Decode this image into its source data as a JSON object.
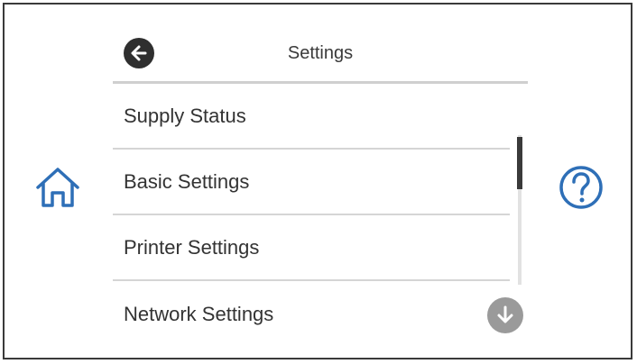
{
  "header": {
    "title": "Settings"
  },
  "menu": {
    "items": [
      {
        "label": "Supply Status"
      },
      {
        "label": "Basic Settings"
      },
      {
        "label": "Printer Settings"
      },
      {
        "label": "Network Settings"
      }
    ]
  },
  "icons": {
    "back": "back-arrow-icon",
    "home": "home-icon",
    "help": "help-icon",
    "scroll_down": "scroll-down-icon"
  },
  "colors": {
    "accent": "#2e6fb7",
    "dark": "#2f2f2f",
    "divider": "#d5d5d5"
  }
}
